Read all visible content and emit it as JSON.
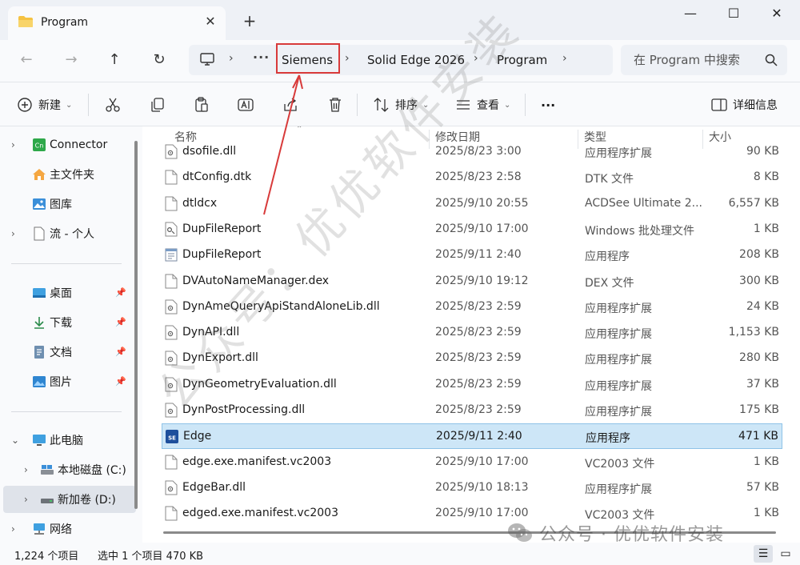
{
  "window": {
    "tab_title": "Program",
    "tab_close": "✕",
    "new_tab": "+",
    "minimize": "—",
    "maximize": "☐",
    "close": "✕"
  },
  "address": {
    "overflow": "···",
    "crumbs": [
      "Siemens",
      "Solid Edge 2026",
      "Program"
    ],
    "search_placeholder": "在 Program 中搜索"
  },
  "toolbar": {
    "new_label": "新建",
    "sort_label": "排序",
    "view_label": "查看",
    "more_label": "···",
    "details_label": "详细信息"
  },
  "sidebar": {
    "items": [
      {
        "label": "Connector",
        "chevron": "›"
      },
      {
        "label": "主文件夹",
        "chevron": ""
      },
      {
        "label": "图库",
        "chevron": ""
      },
      {
        "label": "流 - 个人",
        "chevron": "›"
      },
      {
        "label": "桌面",
        "chevron": ""
      },
      {
        "label": "下载",
        "chevron": ""
      },
      {
        "label": "文档",
        "chevron": ""
      },
      {
        "label": "图片",
        "chevron": ""
      },
      {
        "label": "此电脑",
        "chevron": "⌄"
      },
      {
        "label": "本地磁盘 (C:)",
        "chevron": "›"
      },
      {
        "label": "新加卷 (D:)",
        "chevron": "›"
      },
      {
        "label": "网络",
        "chevron": "›"
      }
    ]
  },
  "columns": {
    "name": "名称",
    "date": "修改日期",
    "type": "类型",
    "size": "大小"
  },
  "files": [
    {
      "name": "dsofile.dll",
      "date": "2025/8/23 3:00",
      "type": "应用程序扩展",
      "size": "90 KB"
    },
    {
      "name": "dtConfig.dtk",
      "date": "2025/8/23 2:58",
      "type": "DTK 文件",
      "size": "8 KB"
    },
    {
      "name": "dtldcx",
      "date": "2025/9/10 20:55",
      "type": "ACDSee Ultimate 2...",
      "size": "6,557 KB"
    },
    {
      "name": "DupFileReport",
      "date": "2025/9/10 17:00",
      "type": "Windows 批处理文件",
      "size": "1 KB"
    },
    {
      "name": "DupFileReport",
      "date": "2025/9/11 2:40",
      "type": "应用程序",
      "size": "208 KB"
    },
    {
      "name": "DVAutoNameManager.dex",
      "date": "2025/9/10 19:12",
      "type": "DEX 文件",
      "size": "300 KB"
    },
    {
      "name": "DynAmeQueryApiStandAloneLib.dll",
      "date": "2025/8/23 2:59",
      "type": "应用程序扩展",
      "size": "24 KB"
    },
    {
      "name": "DynAPI.dll",
      "date": "2025/8/23 2:59",
      "type": "应用程序扩展",
      "size": "1,153 KB"
    },
    {
      "name": "DynExport.dll",
      "date": "2025/8/23 2:59",
      "type": "应用程序扩展",
      "size": "280 KB"
    },
    {
      "name": "DynGeometryEvaluation.dll",
      "date": "2025/8/23 2:59",
      "type": "应用程序扩展",
      "size": "37 KB"
    },
    {
      "name": "DynPostProcessing.dll",
      "date": "2025/8/23 2:59",
      "type": "应用程序扩展",
      "size": "175 KB"
    },
    {
      "name": "Edge",
      "date": "2025/9/11 2:40",
      "type": "应用程序",
      "size": "471 KB"
    },
    {
      "name": "edge.exe.manifest.vc2003",
      "date": "2025/9/10 17:00",
      "type": "VC2003 文件",
      "size": "1 KB"
    },
    {
      "name": "EdgeBar.dll",
      "date": "2025/9/10 18:13",
      "type": "应用程序扩展",
      "size": "57 KB"
    },
    {
      "name": "edged.exe.manifest.vc2003",
      "date": "2025/9/10 17:00",
      "type": "VC2003 文件",
      "size": "1 KB"
    }
  ],
  "status": {
    "item_count": "1,224 个项目",
    "selection": "选中 1 个项目  470 KB"
  },
  "watermark": {
    "diagonal": "公众号：优优软件安装",
    "footer": "公众号 · 优优软件安装"
  },
  "colors": {
    "accent": "#0067c0",
    "selected_row": "#cde6f7",
    "annotation_red": "#d83a3a"
  }
}
